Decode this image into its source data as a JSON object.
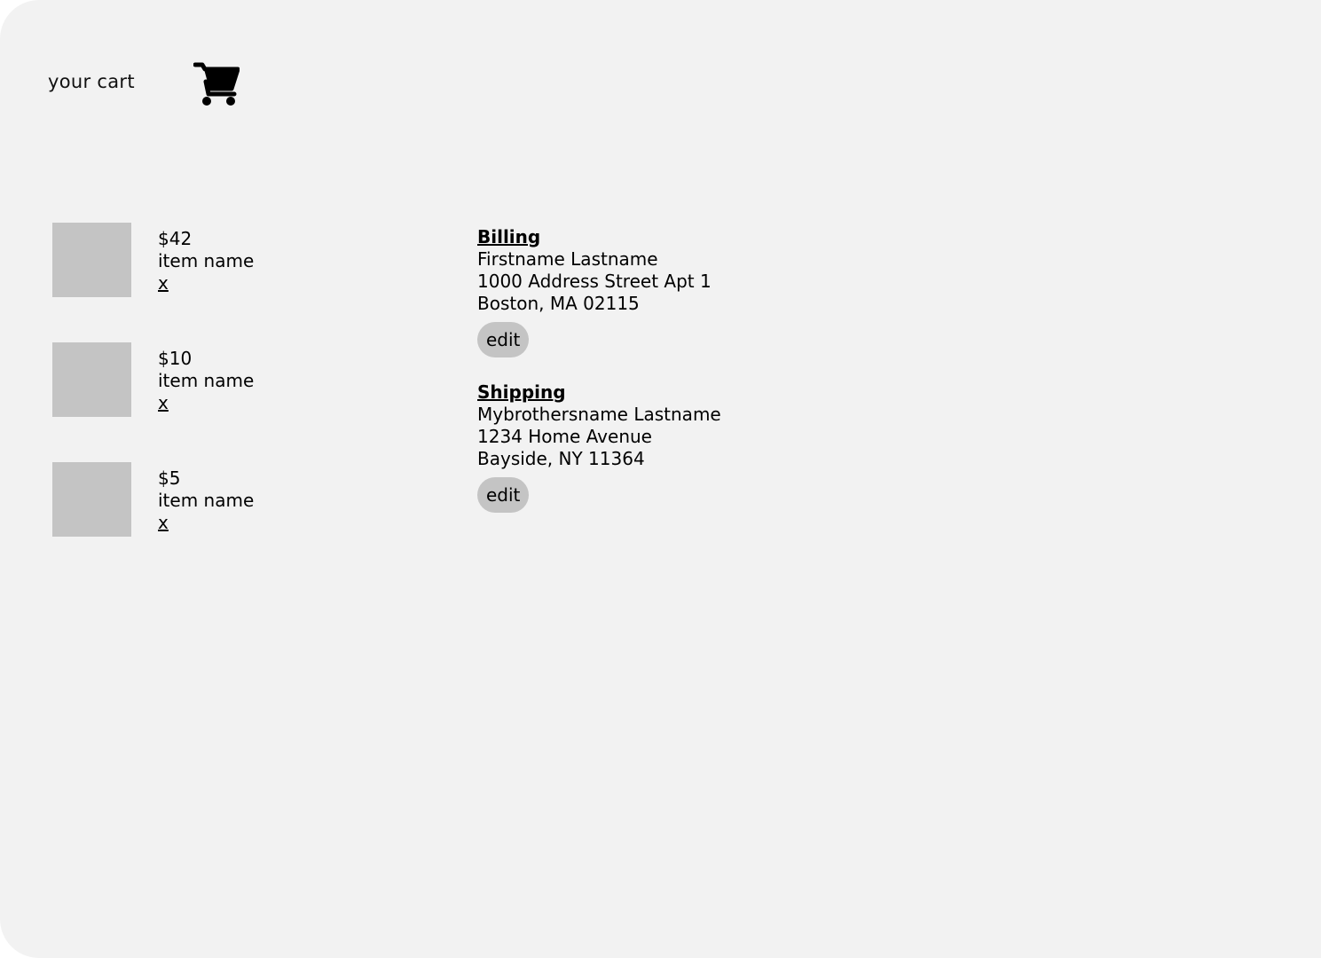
{
  "header": {
    "title": "your cart",
    "cart_icon": "shopping-cart-icon"
  },
  "items": [
    {
      "price": "$42",
      "name": "item name",
      "remove_label": "x"
    },
    {
      "price": "$10",
      "name": "item name",
      "remove_label": "x"
    },
    {
      "price": "$5",
      "name": "item name",
      "remove_label": "x"
    }
  ],
  "billing": {
    "heading": "Billing",
    "name": "Firstname Lastname",
    "street": "1000 Address Street Apt 1",
    "city_line": "Boston, MA 02115",
    "edit_label": "edit"
  },
  "shipping": {
    "heading": "Shipping",
    "name": "Mybrothersname Lastname",
    "street": "1234 Home Avenue",
    "city_line": "Bayside, NY 11364",
    "edit_label": "edit"
  },
  "colors": {
    "background": "#f2f2f2",
    "placeholder": "#c4c4c4",
    "text": "#000000"
  }
}
